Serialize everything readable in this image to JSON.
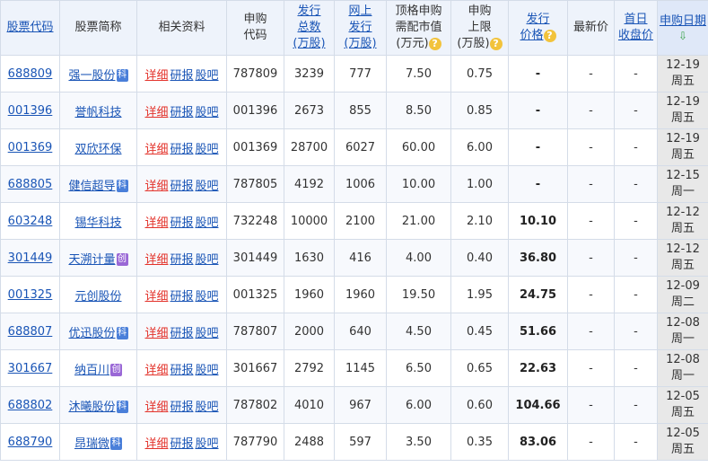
{
  "headers": {
    "code": "股票代码",
    "name": "股票简称",
    "related": "相关资料",
    "apply_code_1": "申购",
    "apply_code_2": "代码",
    "total_1": "发行",
    "total_2": "总数",
    "total_3": "(万股)",
    "online_1": "网上",
    "online_2": "发行",
    "online_3": "(万股)",
    "mv_1": "顶格申购",
    "mv_2": "需配市值",
    "mv_3": "(万元)",
    "limit_1": "申购",
    "limit_2": "上限",
    "limit_3": "(万股)",
    "price_1": "发行",
    "price_2": "价格",
    "latest": "最新价",
    "close_1": "首日",
    "close_2": "收盘价",
    "date": "申购日期"
  },
  "link_labels": {
    "detail": "详细",
    "report": "研报",
    "bar": "股吧"
  },
  "badges": {
    "ke": "科",
    "chuang": "创"
  },
  "rows": [
    {
      "code": "688809",
      "name": "强一股份",
      "badge": "ke",
      "apply_code": "787809",
      "total": "3239",
      "online": "777",
      "mv": "7.50",
      "limit": "0.75",
      "price": "-",
      "latest": "-",
      "close": "-",
      "date": "12-19",
      "weekday": "周五"
    },
    {
      "code": "001396",
      "name": "誉帆科技",
      "badge": "",
      "apply_code": "001396",
      "total": "2673",
      "online": "855",
      "mv": "8.50",
      "limit": "0.85",
      "price": "-",
      "latest": "-",
      "close": "-",
      "date": "12-19",
      "weekday": "周五"
    },
    {
      "code": "001369",
      "name": "双欣环保",
      "badge": "",
      "apply_code": "001369",
      "total": "28700",
      "online": "6027",
      "mv": "60.00",
      "limit": "6.00",
      "price": "-",
      "latest": "-",
      "close": "-",
      "date": "12-19",
      "weekday": "周五"
    },
    {
      "code": "688805",
      "name": "健信超导",
      "badge": "ke",
      "apply_code": "787805",
      "total": "4192",
      "online": "1006",
      "mv": "10.00",
      "limit": "1.00",
      "price": "-",
      "latest": "-",
      "close": "-",
      "date": "12-15",
      "weekday": "周一"
    },
    {
      "code": "603248",
      "name": "锡华科技",
      "badge": "",
      "apply_code": "732248",
      "total": "10000",
      "online": "2100",
      "mv": "21.00",
      "limit": "2.10",
      "price": "10.10",
      "latest": "-",
      "close": "-",
      "date": "12-12",
      "weekday": "周五"
    },
    {
      "code": "301449",
      "name": "天溯计量",
      "badge": "chuang",
      "apply_code": "301449",
      "total": "1630",
      "online": "416",
      "mv": "4.00",
      "limit": "0.40",
      "price": "36.80",
      "latest": "-",
      "close": "-",
      "date": "12-12",
      "weekday": "周五"
    },
    {
      "code": "001325",
      "name": "元创股份",
      "badge": "",
      "apply_code": "001325",
      "total": "1960",
      "online": "1960",
      "mv": "19.50",
      "limit": "1.95",
      "price": "24.75",
      "latest": "-",
      "close": "-",
      "date": "12-09",
      "weekday": "周二"
    },
    {
      "code": "688807",
      "name": "优迅股份",
      "badge": "ke",
      "apply_code": "787807",
      "total": "2000",
      "online": "640",
      "mv": "4.50",
      "limit": "0.45",
      "price": "51.66",
      "latest": "-",
      "close": "-",
      "date": "12-08",
      "weekday": "周一"
    },
    {
      "code": "301667",
      "name": "纳百川",
      "badge": "chuang",
      "apply_code": "301667",
      "total": "2792",
      "online": "1145",
      "mv": "6.50",
      "limit": "0.65",
      "price": "22.63",
      "latest": "-",
      "close": "-",
      "date": "12-08",
      "weekday": "周一"
    },
    {
      "code": "688802",
      "name": "沐曦股份",
      "badge": "ke",
      "apply_code": "787802",
      "total": "4010",
      "online": "967",
      "mv": "6.00",
      "limit": "0.60",
      "price": "104.66",
      "latest": "-",
      "close": "-",
      "date": "12-05",
      "weekday": "周五"
    },
    {
      "code": "688790",
      "name": "昂瑞微",
      "badge": "ke",
      "apply_code": "787790",
      "total": "2488",
      "online": "597",
      "mv": "3.50",
      "limit": "0.35",
      "price": "83.06",
      "latest": "-",
      "close": "-",
      "date": "12-05",
      "weekday": "周五"
    }
  ],
  "icons": {
    "help": "help-circle-icon",
    "sort": "sort-down-arrow-icon"
  },
  "colors": {
    "header_bg": "#eef3fb",
    "link_blue": "#1a55b6",
    "detail_red": "#e3332b",
    "badge_ke": "#4a7fd9",
    "badge_chuang": "#9a68d6",
    "date_bg": "#e8e8e8"
  }
}
